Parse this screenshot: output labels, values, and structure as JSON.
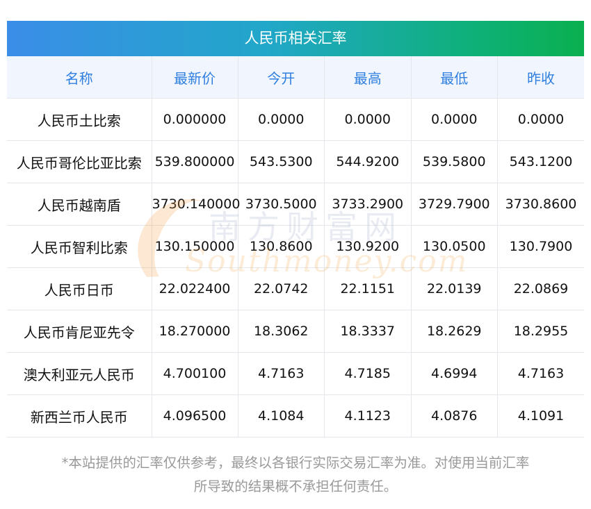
{
  "title": "人民币相关汇率",
  "columns": [
    "名称",
    "最新价",
    "今开",
    "最高",
    "最低",
    "昨收"
  ],
  "rows": [
    {
      "name": "人民币土比索",
      "latest": "0.000000",
      "open": "0.0000",
      "high": "0.0000",
      "low": "0.0000",
      "prev_close": "0.0000"
    },
    {
      "name": "人民币哥伦比亚比索",
      "latest": "539.800000",
      "open": "543.5300",
      "high": "544.9200",
      "low": "539.5800",
      "prev_close": "543.1200"
    },
    {
      "name": "人民币越南盾",
      "latest": "3730.140000",
      "open": "3730.5000",
      "high": "3733.2900",
      "low": "3729.7900",
      "prev_close": "3730.8600"
    },
    {
      "name": "人民币智利比索",
      "latest": "130.150000",
      "open": "130.8600",
      "high": "130.9200",
      "low": "130.0500",
      "prev_close": "130.7900"
    },
    {
      "name": "人民币日币",
      "latest": "22.022400",
      "open": "22.0742",
      "high": "22.1151",
      "low": "22.0139",
      "prev_close": "22.0869"
    },
    {
      "name": "人民币肯尼亚先令",
      "latest": "18.270000",
      "open": "18.3062",
      "high": "18.3337",
      "low": "18.2629",
      "prev_close": "18.2955"
    },
    {
      "name": "澳大利亚元人民币",
      "latest": "4.700100",
      "open": "4.7163",
      "high": "4.7185",
      "low": "4.6994",
      "prev_close": "4.7163"
    },
    {
      "name": "新西兰币人民币",
      "latest": "4.096500",
      "open": "4.1084",
      "high": "4.1123",
      "low": "4.0876",
      "prev_close": "4.1091"
    }
  ],
  "watermark": {
    "cn": "南方财富网",
    "en": "Southmoney.com"
  },
  "footnote": {
    "line1": "*本站提供的汇率仅供参考，最终以各银行实际交易汇率为准。对使用当前汇率",
    "line2": "所导致的结果概不承担任何责任。"
  },
  "colors": {
    "header_gradient_start": "#3b8de8",
    "header_gradient_end": "#0ab04f",
    "column_header_text": "#2f7fe0",
    "column_header_bg": "#f1f6fe",
    "footnote_text": "#999999"
  }
}
